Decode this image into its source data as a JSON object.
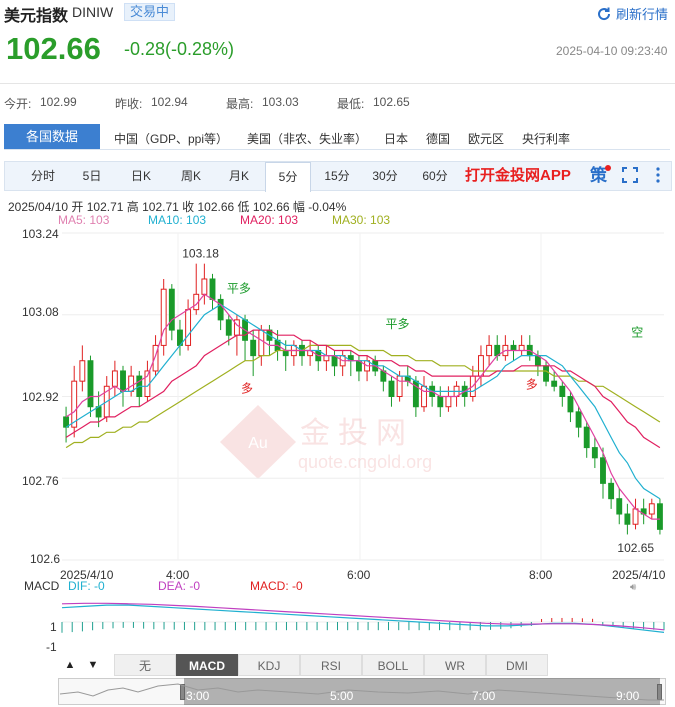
{
  "header": {
    "title": "美元指数",
    "code": "DINIW",
    "status": "交易中",
    "refresh_label": "刷新行情",
    "price": "102.66",
    "change": "-0.28(-0.28%)",
    "timestamp": "2025-04-10 09:23:40"
  },
  "stats": {
    "open_label": "今开:",
    "open": "102.99",
    "prev_label": "昨收:",
    "prev": "102.94",
    "high_label": "最高:",
    "high": "103.03",
    "low_label": "最低:",
    "low": "102.65"
  },
  "nav": {
    "active": "各国数据",
    "items": [
      "中国（GDP、ppi等）",
      "美国（非农、失业率）",
      "日本",
      "德国",
      "欧元区",
      "央行利率"
    ]
  },
  "tabs": {
    "items": [
      "分时",
      "5日",
      "日K",
      "周K",
      "月K",
      "5分",
      "15分",
      "30分",
      "60分"
    ],
    "active": "5分",
    "app": "打开金投网APP",
    "strategy": "策"
  },
  "info": {
    "line1": "2025/04/10  开 102.71  高 102.71  收 102.66  低 102.66  幅 -0.04%",
    "ma5": "MA5: 103",
    "ma10": "MA10: 103",
    "ma20": "MA20: 103",
    "ma30": "MA30: 103"
  },
  "chart_data": {
    "type": "candlestick",
    "y_ticks": [
      "103.24",
      "103.08",
      "102.92",
      "102.76",
      "102.6"
    ],
    "ylim": [
      102.6,
      103.24
    ],
    "x_ticks": [
      "2025/4/10",
      "4:00",
      "6:00",
      "8:00",
      "2025/4/10"
    ],
    "annotations": [
      "103.18",
      "102.65",
      "平多",
      "多",
      "平多",
      "多",
      "空"
    ],
    "colors": {
      "up": "#e02020",
      "down": "#1a9a2a",
      "ma5": "#e040a0",
      "ma10": "#20b0d0",
      "ma20": "#e02060",
      "ma30": "#a0b020"
    },
    "candles": [
      [
        102.88,
        102.86,
        102.9,
        102.83
      ],
      [
        102.86,
        102.95,
        102.98,
        102.84
      ],
      [
        102.95,
        102.99,
        103.02,
        102.93
      ],
      [
        102.99,
        102.9,
        103.0,
        102.88
      ],
      [
        102.9,
        102.88,
        102.93,
        102.86
      ],
      [
        102.88,
        102.94,
        102.96,
        102.87
      ],
      [
        102.94,
        102.97,
        102.99,
        102.92
      ],
      [
        102.97,
        102.93,
        102.98,
        102.9
      ],
      [
        102.93,
        102.96,
        102.98,
        102.92
      ],
      [
        102.96,
        102.92,
        102.97,
        102.9
      ],
      [
        102.92,
        102.97,
        102.99,
        102.91
      ],
      [
        102.97,
        103.02,
        103.04,
        102.96
      ],
      [
        103.02,
        103.13,
        103.15,
        103.0
      ],
      [
        103.13,
        103.05,
        103.14,
        103.03
      ],
      [
        103.05,
        103.02,
        103.07,
        103.0
      ],
      [
        103.02,
        103.09,
        103.11,
        103.01
      ],
      [
        103.09,
        103.12,
        103.18,
        103.08
      ],
      [
        103.12,
        103.15,
        103.18,
        103.1
      ],
      [
        103.15,
        103.11,
        103.16,
        103.09
      ],
      [
        103.11,
        103.07,
        103.12,
        103.05
      ],
      [
        103.07,
        103.04,
        103.08,
        103.02
      ],
      [
        103.04,
        103.07,
        103.08,
        103.0
      ],
      [
        103.07,
        103.03,
        103.08,
        102.99
      ],
      [
        103.03,
        103.0,
        103.05,
        102.96
      ],
      [
        103.0,
        103.05,
        103.06,
        102.98
      ],
      [
        103.05,
        103.03,
        103.06,
        103.0
      ],
      [
        103.03,
        103.01,
        103.05,
        102.99
      ],
      [
        103.01,
        103.0,
        103.03,
        102.97
      ],
      [
        103.0,
        103.02,
        103.03,
        102.98
      ],
      [
        103.02,
        103.0,
        103.03,
        102.98
      ],
      [
        103.0,
        103.01,
        103.03,
        102.98
      ],
      [
        103.01,
        102.99,
        103.02,
        102.97
      ],
      [
        102.99,
        103.0,
        103.02,
        102.97
      ],
      [
        103.0,
        102.98,
        103.01,
        102.96
      ],
      [
        102.98,
        103.0,
        103.01,
        102.96
      ],
      [
        103.0,
        102.99,
        103.01,
        102.96
      ],
      [
        102.99,
        102.97,
        103.0,
        102.95
      ],
      [
        102.97,
        102.99,
        103.0,
        102.95
      ],
      [
        102.99,
        102.97,
        103.0,
        102.96
      ],
      [
        102.97,
        102.95,
        102.98,
        102.93
      ],
      [
        102.95,
        102.92,
        102.96,
        102.9
      ],
      [
        102.92,
        102.96,
        102.97,
        102.91
      ],
      [
        102.96,
        102.95,
        102.98,
        102.94
      ],
      [
        102.95,
        102.9,
        102.96,
        102.88
      ],
      [
        102.9,
        102.94,
        102.96,
        102.89
      ],
      [
        102.94,
        102.92,
        102.95,
        102.9
      ],
      [
        102.92,
        102.9,
        102.94,
        102.88
      ],
      [
        102.9,
        102.92,
        102.94,
        102.89
      ],
      [
        102.92,
        102.94,
        102.95,
        102.9
      ],
      [
        102.94,
        102.92,
        102.95,
        102.9
      ],
      [
        102.92,
        102.96,
        102.98,
        102.91
      ],
      [
        102.96,
        103.0,
        103.02,
        102.94
      ],
      [
        103.0,
        103.02,
        103.04,
        102.98
      ],
      [
        103.02,
        103.0,
        103.04,
        102.99
      ],
      [
        103.0,
        103.02,
        103.04,
        102.99
      ],
      [
        103.02,
        103.01,
        103.03,
        102.99
      ],
      [
        103.01,
        103.02,
        103.04,
        103.0
      ],
      [
        103.02,
        103.0,
        103.04,
        102.99
      ],
      [
        103.0,
        102.98,
        103.01,
        102.96
      ],
      [
        102.98,
        102.95,
        102.99,
        102.94
      ],
      [
        102.95,
        102.94,
        102.97,
        102.93
      ],
      [
        102.94,
        102.92,
        102.95,
        102.9
      ],
      [
        102.92,
        102.89,
        102.93,
        102.87
      ],
      [
        102.89,
        102.86,
        102.9,
        102.84
      ],
      [
        102.86,
        102.82,
        102.87,
        102.8
      ],
      [
        102.82,
        102.8,
        102.84,
        102.78
      ],
      [
        102.8,
        102.75,
        102.82,
        102.72
      ],
      [
        102.75,
        102.72,
        102.76,
        102.7
      ],
      [
        102.72,
        102.69,
        102.74,
        102.67
      ],
      [
        102.69,
        102.67,
        102.71,
        102.65
      ],
      [
        102.67,
        102.7,
        102.72,
        102.66
      ],
      [
        102.7,
        102.69,
        102.72,
        102.67
      ],
      [
        102.69,
        102.71,
        102.72,
        102.68
      ],
      [
        102.71,
        102.66,
        102.72,
        102.65
      ]
    ],
    "ma": {
      "ma5": [
        102.88,
        102.89,
        102.91,
        102.92,
        102.92,
        102.93,
        102.94,
        102.93,
        102.94,
        102.95,
        102.96,
        103.0,
        103.05,
        103.07,
        103.08,
        103.09,
        103.1,
        103.12,
        103.11,
        103.1,
        103.08,
        103.06,
        103.05,
        103.04,
        103.03,
        103.02,
        103.02,
        103.01,
        103.01,
        103.01,
        103.01,
        103.0,
        103.0,
        103.0,
        102.99,
        102.99,
        102.99,
        102.98,
        102.98,
        102.97,
        102.96,
        102.95,
        102.95,
        102.94,
        102.93,
        102.93,
        102.92,
        102.92,
        102.92,
        102.93,
        102.94,
        102.96,
        102.98,
        103.0,
        103.01,
        103.01,
        103.01,
        103.01,
        103.0,
        102.99,
        102.97,
        102.95,
        102.93,
        102.9,
        102.87,
        102.84,
        102.81,
        102.77,
        102.74,
        102.72,
        102.7,
        102.69,
        102.68,
        102.68
      ],
      "ma10": [
        102.86,
        102.87,
        102.88,
        102.89,
        102.9,
        102.91,
        102.92,
        102.93,
        102.93,
        102.94,
        102.94,
        102.96,
        102.98,
        103.0,
        103.02,
        103.04,
        103.06,
        103.08,
        103.09,
        103.1,
        103.09,
        103.08,
        103.07,
        103.06,
        103.05,
        103.04,
        103.03,
        103.02,
        103.02,
        103.01,
        103.01,
        103.01,
        103.0,
        103.0,
        103.0,
        102.99,
        102.99,
        102.99,
        102.98,
        102.98,
        102.97,
        102.96,
        102.96,
        102.95,
        102.94,
        102.93,
        102.93,
        102.93,
        102.93,
        102.93,
        102.93,
        102.94,
        102.95,
        102.96,
        102.98,
        102.99,
        103.0,
        103.0,
        103.0,
        103.0,
        102.99,
        102.98,
        102.96,
        102.94,
        102.92,
        102.9,
        102.87,
        102.84,
        102.81,
        102.79,
        102.76,
        102.74,
        102.73,
        102.72
      ],
      "ma20": [
        102.84,
        102.85,
        102.86,
        102.87,
        102.87,
        102.88,
        102.88,
        102.89,
        102.9,
        102.9,
        102.91,
        102.92,
        102.93,
        102.95,
        102.96,
        102.97,
        102.98,
        103.0,
        103.01,
        103.02,
        103.03,
        103.04,
        103.04,
        103.05,
        103.05,
        103.05,
        103.04,
        103.04,
        103.04,
        103.03,
        103.03,
        103.02,
        103.02,
        103.01,
        103.01,
        103.01,
        103.0,
        103.0,
        102.99,
        102.99,
        102.99,
        102.98,
        102.98,
        102.97,
        102.97,
        102.96,
        102.96,
        102.96,
        102.96,
        102.96,
        102.96,
        102.96,
        102.96,
        102.97,
        102.97,
        102.97,
        102.98,
        102.98,
        102.98,
        102.98,
        102.98,
        102.97,
        102.97,
        102.96,
        102.95,
        102.94,
        102.92,
        102.91,
        102.89,
        102.87,
        102.86,
        102.84,
        102.83,
        102.82
      ],
      "ma30": [
        102.82,
        102.83,
        102.83,
        102.84,
        102.84,
        102.85,
        102.85,
        102.86,
        102.86,
        102.87,
        102.87,
        102.88,
        102.89,
        102.9,
        102.91,
        102.92,
        102.93,
        102.94,
        102.95,
        102.96,
        102.97,
        102.98,
        102.99,
        102.99,
        103.0,
        103.0,
        103.01,
        103.01,
        103.01,
        103.01,
        103.02,
        103.02,
        103.02,
        103.02,
        103.02,
        103.02,
        103.01,
        103.01,
        103.01,
        103.01,
        103.0,
        103.0,
        103.0,
        102.99,
        102.99,
        102.99,
        102.98,
        102.98,
        102.98,
        102.98,
        102.97,
        102.97,
        102.97,
        102.97,
        102.97,
        102.97,
        102.97,
        102.97,
        102.97,
        102.97,
        102.96,
        102.96,
        102.96,
        102.95,
        102.95,
        102.94,
        102.94,
        102.93,
        102.92,
        102.91,
        102.9,
        102.89,
        102.88,
        102.87
      ]
    }
  },
  "macd": {
    "label": "MACD",
    "dif": "DIF: -0",
    "dea": "DEA: -0",
    "macd_val": "MACD: -0",
    "y_top": "1",
    "y_bottom": "-1",
    "dif_series": [
      0.55,
      0.6,
      0.65,
      0.65,
      0.6,
      0.55,
      0.5,
      0.45,
      0.4,
      0.35,
      0.3,
      0.25,
      0.2,
      0.15,
      0.1,
      0.05,
      0.0,
      -0.05,
      -0.1,
      -0.15,
      -0.15,
      -0.1,
      -0.05,
      -0.05,
      -0.1,
      -0.2,
      -0.3,
      -0.4
    ],
    "dea_series": [
      0.7,
      0.72,
      0.72,
      0.7,
      0.68,
      0.64,
      0.6,
      0.55,
      0.5,
      0.45,
      0.4,
      0.35,
      0.3,
      0.25,
      0.2,
      0.15,
      0.1,
      0.05,
      0.0,
      -0.05,
      -0.08,
      -0.08,
      -0.07,
      -0.07,
      -0.1,
      -0.15,
      -0.22,
      -0.3
    ]
  },
  "indicators": {
    "items": [
      "无",
      "MACD",
      "KDJ",
      "RSI",
      "BOLL",
      "WR",
      "DMI"
    ],
    "active": "MACD",
    "up": "▲",
    "down": "▼"
  },
  "navigator": {
    "ticks": [
      "3:00",
      "5:00",
      "7:00",
      "9:00"
    ]
  },
  "watermark": {
    "brand": "金投网",
    "url": "quote.cngold.org"
  }
}
